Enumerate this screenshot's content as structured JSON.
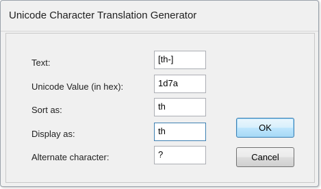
{
  "window": {
    "title": "Unicode Character Translation Generator"
  },
  "form": {
    "text": {
      "label": "Text:",
      "value": "[th-]"
    },
    "unicode_value": {
      "label": "Unicode Value (in hex):",
      "value": "1d7a"
    },
    "sort_as": {
      "label": "Sort as:",
      "value": "th"
    },
    "display_as": {
      "label": "Display as:",
      "value": "th"
    },
    "alternate_character": {
      "label": "Alternate character:",
      "value": "?"
    }
  },
  "buttons": {
    "ok_label": "OK",
    "cancel_label": "Cancel"
  }
}
